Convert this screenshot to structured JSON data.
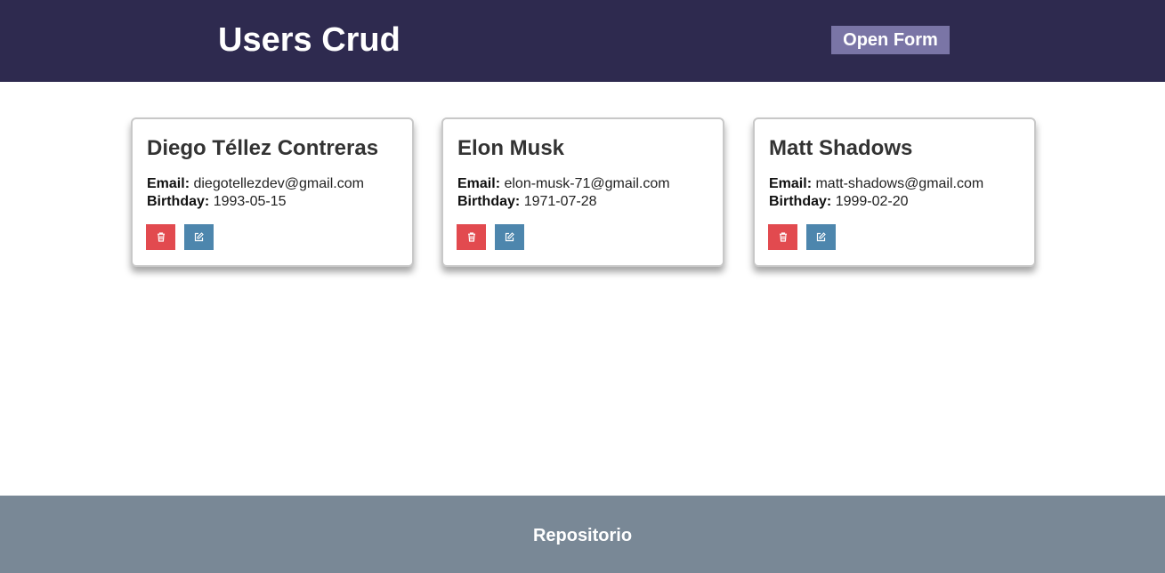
{
  "header": {
    "title": "Users Crud",
    "open_form_label": "Open Form"
  },
  "users": [
    {
      "name": "Diego Téllez Contreras",
      "email_label": "Email:",
      "email": "diegotellezdev@gmail.com",
      "birthday_label": "Birthday:",
      "birthday": "1993-05-15"
    },
    {
      "name": "Elon Musk",
      "email_label": "Email:",
      "email": "elon-musk-71@gmail.com",
      "birthday_label": "Birthday:",
      "birthday": "1971-07-28"
    },
    {
      "name": "Matt Shadows",
      "email_label": "Email:",
      "email": "matt-shadows@gmail.com",
      "birthday_label": "Birthday:",
      "birthday": "1999-02-20"
    }
  ],
  "icons": {
    "delete": "trash-icon",
    "edit": "edit-icon"
  },
  "colors": {
    "header_bg": "#2e2a4f",
    "open_form_bg": "#7a75a6",
    "delete_bg": "#e24a4f",
    "edit_bg": "#4d86ad",
    "footer_bg": "#798896"
  },
  "footer": {
    "link_label": "Repositorio"
  }
}
